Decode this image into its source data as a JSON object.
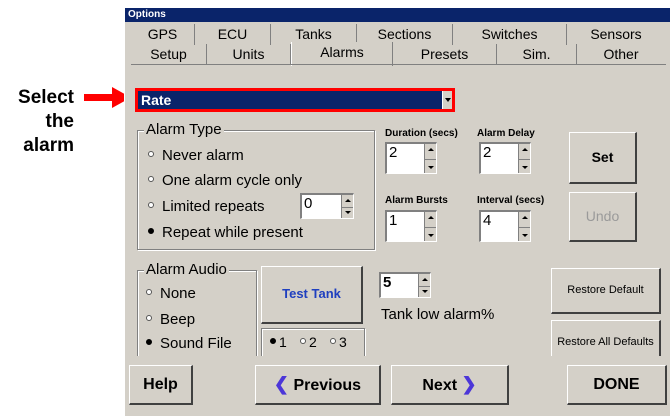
{
  "annotation": {
    "text": "Select the alarm",
    "arrow_color": "#ff0000"
  },
  "window": {
    "title": "Options"
  },
  "tabs": {
    "row1": [
      "GPS",
      "ECU",
      "Tanks",
      "Sections",
      "Switches",
      "Sensors"
    ],
    "row2": [
      "Setup",
      "Units",
      "Alarms",
      "Presets",
      "Sim.",
      "Other"
    ],
    "active": "Alarms"
  },
  "alarm_select": {
    "value": "Rate",
    "highlight_color": "#ff0000"
  },
  "alarm_type": {
    "title": "Alarm Type",
    "options": [
      "Never alarm",
      "One alarm cycle only",
      "Limited repeats",
      "Repeat while present"
    ],
    "selected": "Repeat while present",
    "limited_repeats_value": "0"
  },
  "duration": {
    "label": "Duration (secs)",
    "value": "2"
  },
  "alarm_delay": {
    "label": "Alarm Delay",
    "value": "2"
  },
  "alarm_bursts": {
    "label": "Alarm Bursts",
    "value": "1"
  },
  "interval": {
    "label": "Interval (secs)",
    "value": "4"
  },
  "buttons": {
    "set": "Set",
    "undo": "Undo",
    "test_tank": "Test Tank",
    "restore_default": "Restore Default",
    "restore_all": "Restore All Defaults"
  },
  "alarm_audio": {
    "title": "Alarm Audio",
    "options": [
      "None",
      "Beep",
      "Sound File"
    ],
    "selected": "Sound File"
  },
  "file_choice": {
    "options": [
      "1",
      "2",
      "3"
    ],
    "selected": "1"
  },
  "tank_low": {
    "value": "5",
    "label": "Tank low alarm%"
  },
  "nav": {
    "help": "Help",
    "previous": "Previous",
    "next": "Next",
    "done": "DONE"
  },
  "colors": {
    "title_bar": "#0a246a",
    "dialog_bg": "#d4d0c8",
    "link_blue": "#1f3fbf",
    "nav_arrow": "#4c36d8"
  }
}
